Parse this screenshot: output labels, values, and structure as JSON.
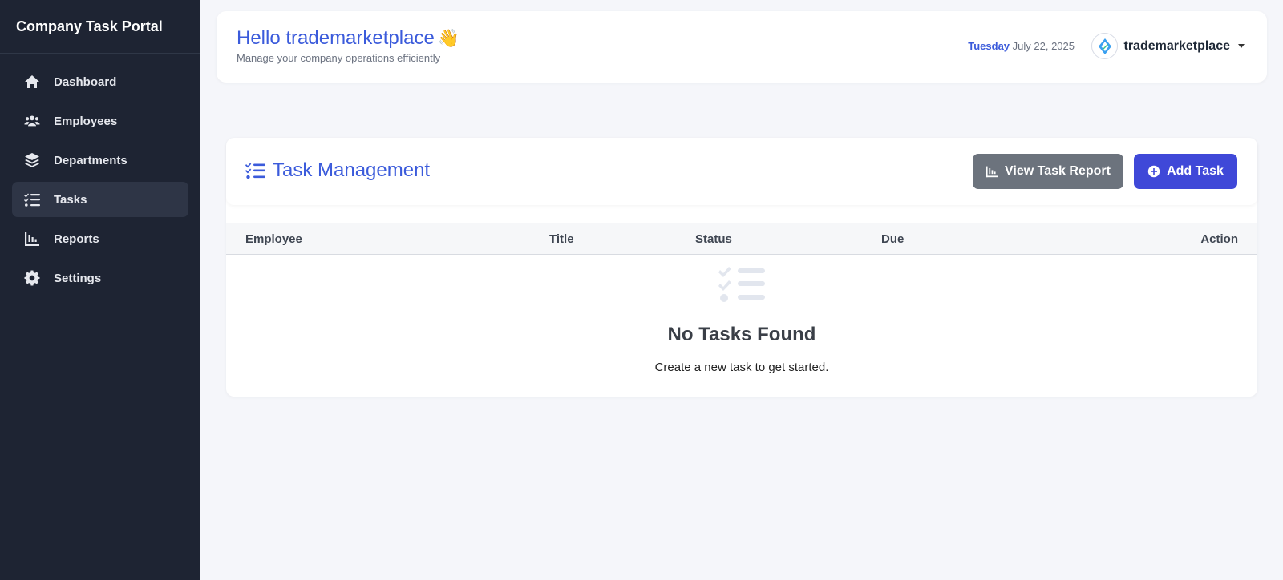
{
  "sidebar": {
    "brand": "Company Task Portal",
    "items": [
      {
        "label": "Dashboard",
        "icon": "home-icon"
      },
      {
        "label": "Employees",
        "icon": "users-icon"
      },
      {
        "label": "Departments",
        "icon": "layers-icon"
      },
      {
        "label": "Tasks",
        "icon": "tasks-icon",
        "active": true
      },
      {
        "label": "Reports",
        "icon": "chart-icon"
      },
      {
        "label": "Settings",
        "icon": "gear-icon"
      }
    ]
  },
  "header": {
    "greeting": "Hello trademarketplace",
    "wave": "👋",
    "subtitle": "Manage your company operations efficiently",
    "day": "Tuesday",
    "date": "July 22, 2025",
    "username": "trademarketplace"
  },
  "tasks": {
    "title": "Task Management",
    "report_button": "View Task Report",
    "add_button": "Add Task",
    "columns": [
      "Employee",
      "Title",
      "Status",
      "Due",
      "Action"
    ],
    "empty_title": "No Tasks Found",
    "empty_text": "Create a new task to get started."
  },
  "colors": {
    "sidebar_bg": "#1e2433",
    "accent": "#3b5bdb",
    "add_button": "#3f48d8",
    "report_button": "#6c737d"
  }
}
